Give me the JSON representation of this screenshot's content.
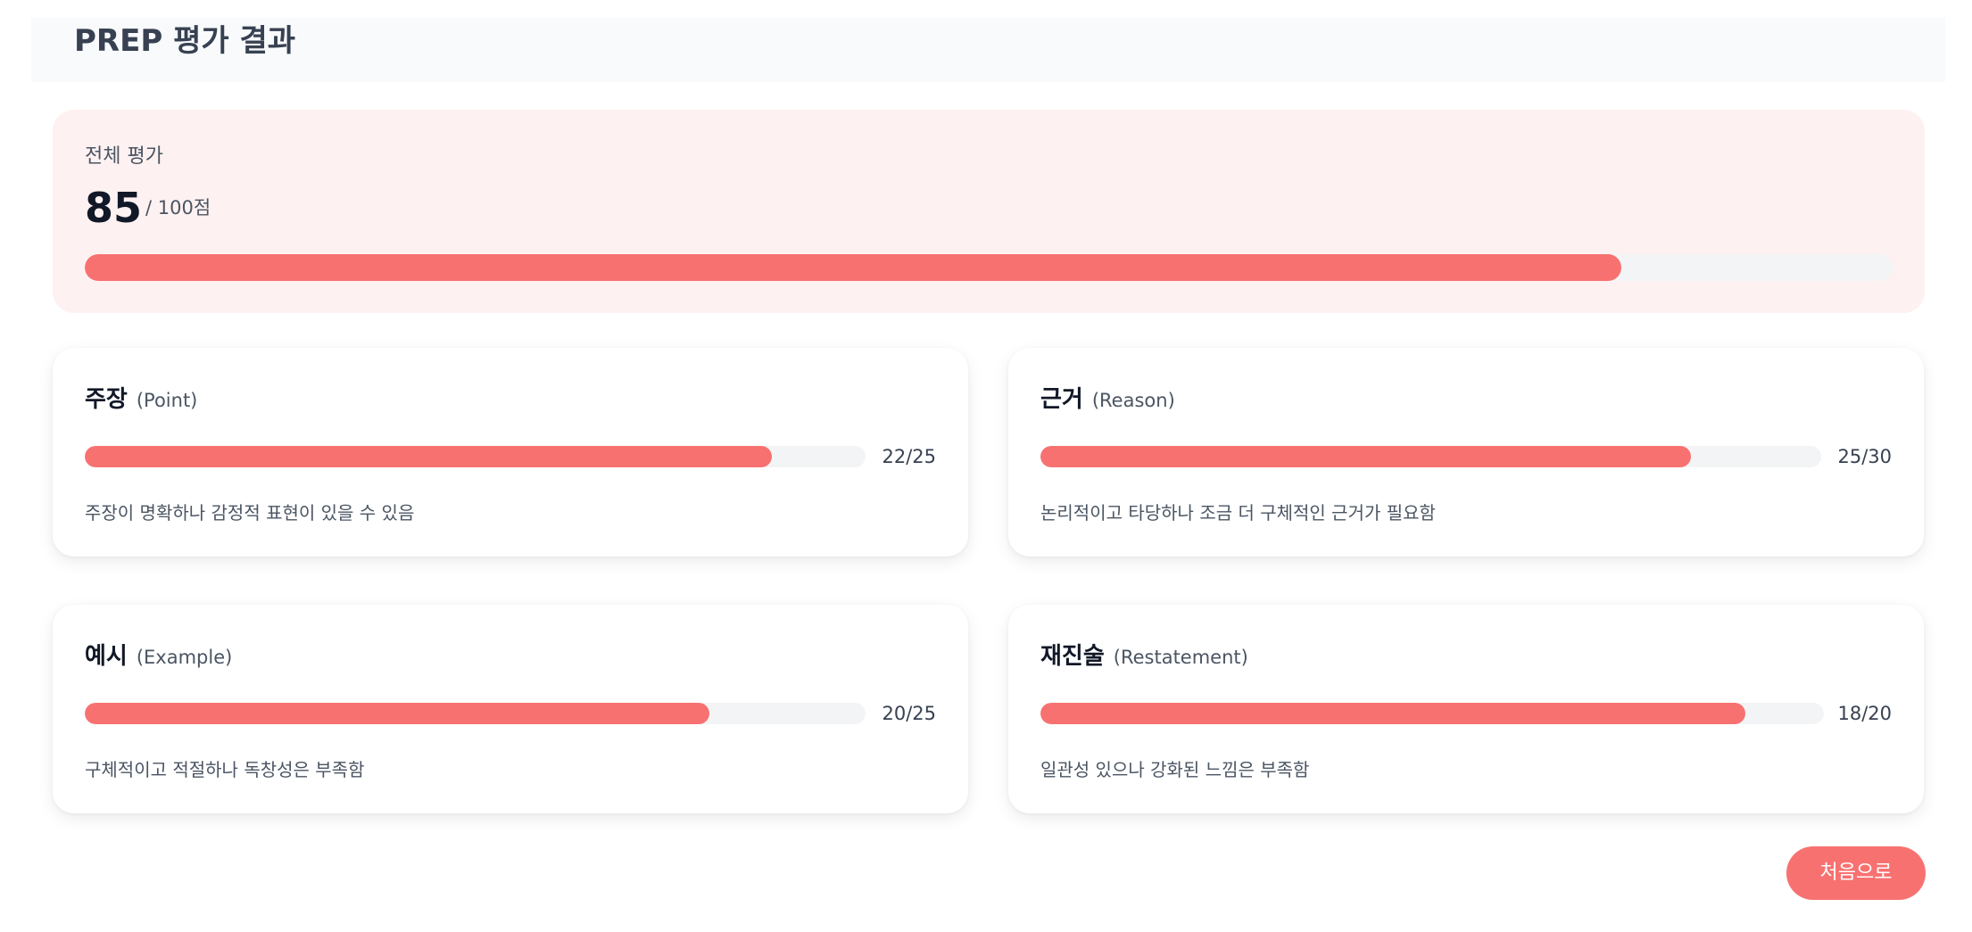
{
  "header": {
    "title": "PREP 평가 결과"
  },
  "overall": {
    "label": "전체 평가",
    "score": "85",
    "total": "/ 100점",
    "progress_fraction": 0.85
  },
  "cards": [
    {
      "title": "주장",
      "subtitle": "(Point)",
      "score_text": "22/25",
      "fraction": 0.88,
      "comment": "주장이 명확하나 감정적 표현이 있을 수 있음"
    },
    {
      "title": "근거",
      "subtitle": "(Reason)",
      "score_text": "25/30",
      "fraction": 0.8333,
      "comment": "논리적이고 타당하나 조금 더 구체적인 근거가 필요함"
    },
    {
      "title": "예시",
      "subtitle": "(Example)",
      "score_text": "20/25",
      "fraction": 0.8,
      "comment": "구체적이고 적절하나 독창성은 부족함"
    },
    {
      "title": "재진술",
      "subtitle": "(Restatement)",
      "score_text": "18/20",
      "fraction": 0.9,
      "comment": "일관성 있으나 강화된 느낌은 부족함"
    }
  ],
  "restart_button": {
    "label": "처음으로"
  },
  "colors": {
    "accent": "#f87171",
    "track": "#f3f4f6",
    "overall_bg": "#fef1f1",
    "header_bg": "#f8fafc"
  }
}
